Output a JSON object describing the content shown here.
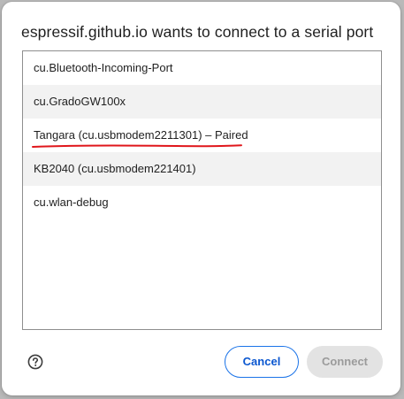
{
  "dialog": {
    "title": "espressif.github.io wants to connect to a serial port"
  },
  "ports": [
    {
      "label": "cu.Bluetooth-Incoming-Port"
    },
    {
      "label": "cu.GradoGW100x"
    },
    {
      "label": "Tangara (cu.usbmodem2211301) – Paired"
    },
    {
      "label": "KB2040 (cu.usbmodem221401)"
    },
    {
      "label": "cu.wlan-debug"
    }
  ],
  "annotation": {
    "underline_color": "#e0161b",
    "underlined_item": "Tangara (cu.usbmodem2211301) – Paired"
  },
  "buttons": {
    "cancel_label": "Cancel",
    "connect_label": "Connect"
  },
  "icons": {
    "help": "help-circle-icon"
  },
  "colors": {
    "accent": "#0b57d0",
    "disabled_bg": "#e3e3e3",
    "disabled_text": "#9b9b9b",
    "alt_row_bg": "#f2f2f2"
  }
}
